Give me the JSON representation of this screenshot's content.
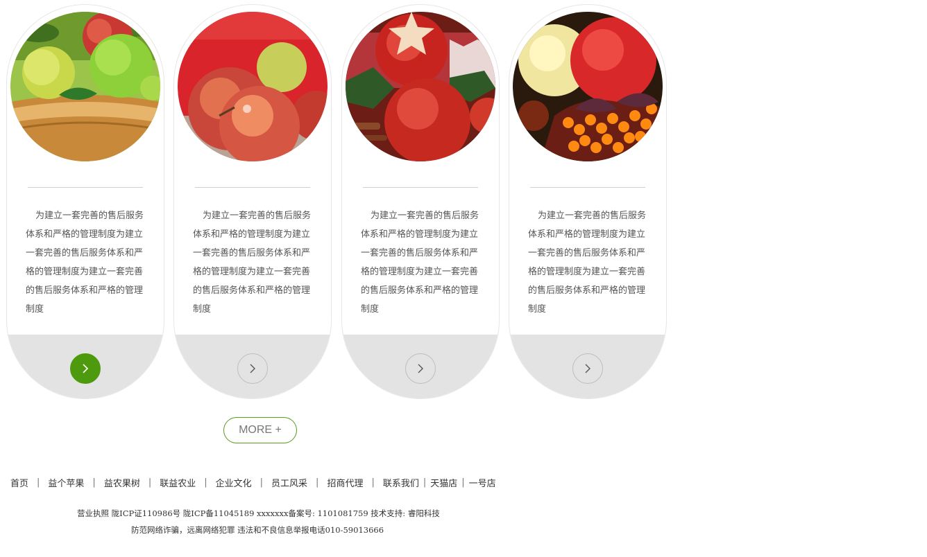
{
  "products": {
    "items": [
      {
        "image": "apples-in-wooden-bowl",
        "description": "为建立一套完善的售后服务体系和严格的管理制度为建立一套完善的售后服务体系和严格的管理制度为建立一套完善的售后服务体系和严格的管理制度",
        "arrow_icon": "chevron-right-icon",
        "active": true
      },
      {
        "image": "red-apples-with-water-drops",
        "description": "为建立一套完善的售后服务体系和严格的管理制度为建立一套完善的售后服务体系和严格的管理制度为建立一套完善的售后服务体系和严格的管理制度",
        "arrow_icon": "chevron-right-icon",
        "active": false
      },
      {
        "image": "apple-with-star-cutout",
        "description": "为建立一套完善的售后服务体系和严格的管理制度为建立一套完善的售后服务体系和严格的管理制度为建立一套完善的售后服务体系和严格的管理制度",
        "arrow_icon": "chevron-right-icon",
        "active": false
      },
      {
        "image": "apples-with-sea-buckthorn",
        "description": "为建立一套完善的售后服务体系和严格的管理制度为建立一套完善的售后服务体系和严格的管理制度为建立一套完善的售后服务体系和严格的管理制度",
        "arrow_icon": "chevron-right-icon",
        "active": false
      }
    ]
  },
  "more_button": {
    "label": "MORE +"
  },
  "footer": {
    "nav": [
      "首页",
      "益个苹果",
      "益农果树",
      "联益农业",
      "企业文化",
      "员工风采",
      "招商代理",
      "联系我们",
      "天猫店",
      "一号店"
    ],
    "info_line1": "营业执照 陇ICP证110986号  陇ICP备11045189  xxxxxxx备案号: 1101081759  技术支持: 睿阳科技",
    "info_line2": "防范网络诈骗，远离网络犯罪  违法和不良信息举报电话010-59013666"
  },
  "colors": {
    "accent_green": "#4e9a0e",
    "card_bottom_gray": "#e3e3e3",
    "more_border": "#5a9a1e"
  }
}
